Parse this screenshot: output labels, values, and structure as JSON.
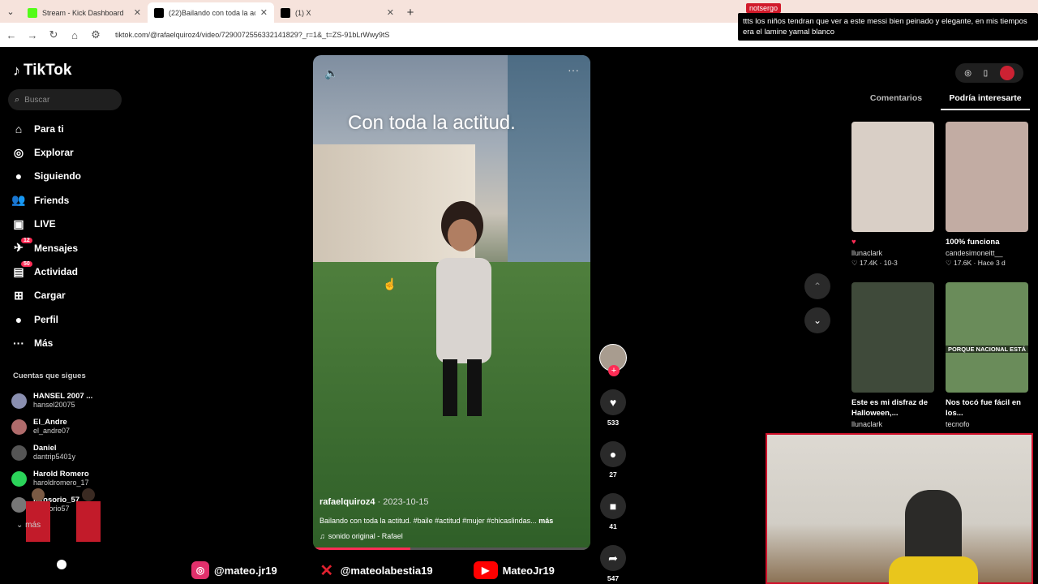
{
  "browser": {
    "tabs": [
      {
        "title": "Stream - Kick Dashboard",
        "favicon_color": "#53fc18"
      },
      {
        "title": "(22)Bailando con toda la ac",
        "favicon_color": "#000000"
      },
      {
        "title": "(1) X",
        "favicon_color": "#000000"
      }
    ],
    "url": "tiktok.com/@rafaelquiroz4/video/7290072556332141829?_r=1&_t=ZS-91bLrWwy9tS"
  },
  "chat_overlay": {
    "username": "notsergo",
    "message": "ttts los niños tendran que ver a este messi bien peinado y elegante, en mis tiempos era el lamine yamal blanco"
  },
  "tiktok": {
    "logo": "TikTok",
    "search_placeholder": "Buscar",
    "nav": [
      {
        "label": "Para ti",
        "icon": "home-icon",
        "glyph": "⌂"
      },
      {
        "label": "Explorar",
        "icon": "compass-icon",
        "glyph": "◎"
      },
      {
        "label": "Siguiendo",
        "icon": "following-avatar-icon",
        "glyph": "●"
      },
      {
        "label": "Friends",
        "icon": "friends-icon",
        "glyph": "👥"
      },
      {
        "label": "LIVE",
        "icon": "live-icon",
        "glyph": "▣"
      },
      {
        "label": "Mensajes",
        "icon": "messages-icon",
        "glyph": "✈",
        "badge": "12"
      },
      {
        "label": "Actividad",
        "icon": "activity-icon",
        "glyph": "▤",
        "badge": "50"
      },
      {
        "label": "Cargar",
        "icon": "upload-icon",
        "glyph": "⊞"
      },
      {
        "label": "Perfil",
        "icon": "profile-icon",
        "glyph": "●"
      },
      {
        "label": "Más",
        "icon": "more-icon",
        "glyph": "···"
      }
    ],
    "following_title": "Cuentas que sigues",
    "following": [
      {
        "name": "HANSEL 2007 ...",
        "handle": "hansel20075",
        "color": "#8a8fb0"
      },
      {
        "name": "El_Andre",
        "handle": "el_andre07",
        "color": "#b06b6b"
      },
      {
        "name": "Daniel",
        "handle": "dantrip5401y",
        "color": "#555555"
      },
      {
        "name": "Harold Romero",
        "handle": "haroldromero_17",
        "color": "#2bd45a"
      },
      {
        "name": "jorosorio_57",
        "handle": "jorosorio57",
        "color": "#777777"
      }
    ],
    "see_more": "más"
  },
  "video": {
    "overlay_text": "Con toda la actitud.",
    "author": "rafaelquiroz4",
    "date": "2023-10-15",
    "description": "Bailando con toda la actitud. #baile #actitud #mujer #chicaslindas...",
    "more": "más",
    "sound": "sonido original - Rafael"
  },
  "actions": {
    "likes": "533",
    "comments": "27",
    "saves": "41",
    "shares": "547"
  },
  "right_panel": {
    "tabs": [
      "Comentarios",
      "Podría interesarte"
    ],
    "cards": [
      {
        "title": "♥",
        "author": "llunaclark",
        "stats": "♡ 17.4K · 10-3",
        "thumb": "#d9cfc6"
      },
      {
        "title": "100% funciona",
        "author": "candesimoneitt__",
        "stats": "♡ 17.6K · Hace 3 d",
        "thumb": "#c2aca3"
      },
      {
        "title": "Este es mi disfraz de Halloween,...",
        "author": "llunaclark",
        "stats": "",
        "thumb": "#3f4a3a"
      },
      {
        "title": "Nos tocó fue fácil en los...",
        "author": "tecnofo",
        "stats": "",
        "thumb": "#6a8c5a",
        "overlay": "PORQUE NACIONAL ESTÁ"
      }
    ]
  },
  "stream_overlay": {
    "instagram": "@mateo.jr19",
    "x": "@mateolabestia19",
    "youtube": "MateoJr19"
  }
}
